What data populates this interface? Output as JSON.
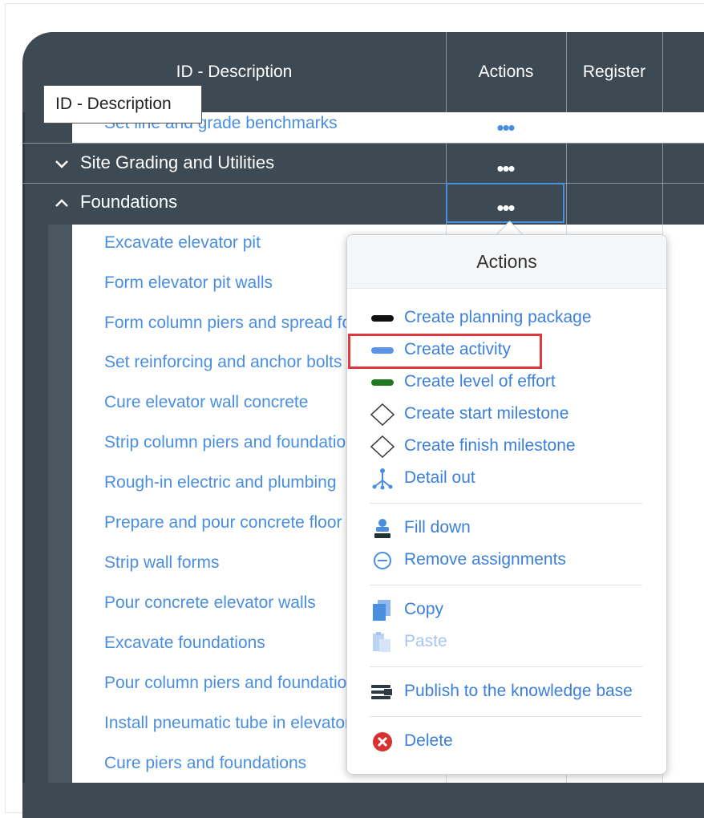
{
  "grid": {
    "headers": {
      "description": "ID - Description",
      "actions": "Actions",
      "register": "Register"
    },
    "tooltip": "ID - Description",
    "top_partial_row": "Set line and grade benchmarks",
    "groups": [
      {
        "label": "Site Grading and Utilities",
        "expanded": false
      },
      {
        "label": "Foundations",
        "expanded": true
      }
    ],
    "children": [
      "Excavate elevator pit",
      "Form elevator pit walls",
      "Form column piers and spread footings",
      "Set reinforcing and anchor bolts",
      "Cure elevator wall concrete",
      "Strip column piers and foundation forms",
      "Rough-in electric and plumbing",
      "Prepare and pour concrete floor",
      "Strip wall forms",
      "Pour concrete elevator walls",
      "Excavate foundations",
      "Pour column piers and foundations",
      "Install pneumatic tube in elevator pit",
      "Cure piers and foundations"
    ],
    "more_glyph": "•••"
  },
  "menu": {
    "title": "Actions",
    "items": [
      {
        "label": "Create planning package",
        "icon": "black-bar-icon"
      },
      {
        "label": "Create activity",
        "icon": "blue-bar-icon"
      },
      {
        "label": "Create level of effort",
        "icon": "green-bar-icon"
      },
      {
        "label": "Create start milestone",
        "icon": "diamond-icon"
      },
      {
        "label": "Create finish milestone",
        "icon": "diamond-icon"
      },
      {
        "label": "Detail out",
        "icon": "branch-icon"
      },
      {
        "label": "Fill down",
        "icon": "fill-down-icon"
      },
      {
        "label": "Remove assignments",
        "icon": "minus-circle-icon"
      },
      {
        "label": "Copy",
        "icon": "copy-icon"
      },
      {
        "label": "Paste",
        "icon": "paste-icon",
        "disabled": true
      },
      {
        "label": "Publish to the knowledge base",
        "icon": "stack-icon"
      },
      {
        "label": "Delete",
        "icon": "delete-icon"
      }
    ],
    "highlighted_item": "Create activity"
  },
  "colors": {
    "grid_bg": "#3d4a54",
    "link": "#4a8ee0",
    "highlight": "#e0383e",
    "delete_red": "#d93030"
  }
}
